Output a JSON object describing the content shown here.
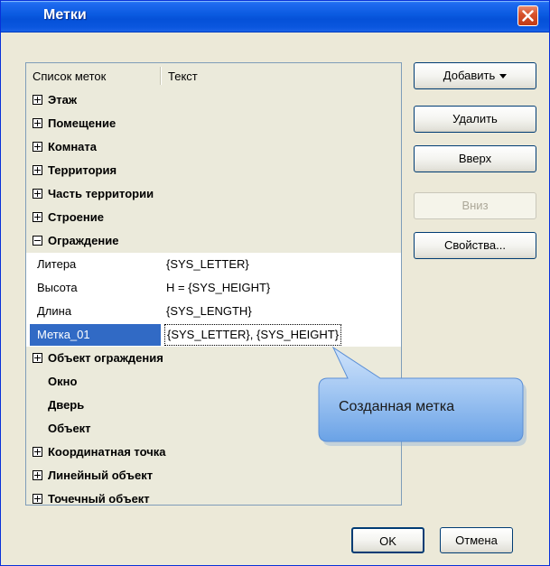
{
  "window": {
    "title": "Метки"
  },
  "list": {
    "headers": {
      "col1": "Список меток",
      "col2": "Текст"
    },
    "groups": [
      {
        "label": "Этаж",
        "expander": "plus"
      },
      {
        "label": "Помещение",
        "expander": "plus"
      },
      {
        "label": "Комната",
        "expander": "plus"
      },
      {
        "label": "Территория",
        "expander": "plus"
      },
      {
        "label": "Часть территории",
        "expander": "plus"
      },
      {
        "label": "Строение",
        "expander": "plus"
      },
      {
        "label": "Ограждение",
        "expander": "minus"
      }
    ],
    "items": [
      {
        "name": "Литера",
        "text": "{SYS_LETTER}"
      },
      {
        "name": "Высота",
        "text": "H = {SYS_HEIGHT}"
      },
      {
        "name": "Длина",
        "text": "{SYS_LENGTH}"
      },
      {
        "name": "Метка_01",
        "text": "{SYS_LETTER}, {SYS_HEIGHT}",
        "selected": true
      }
    ],
    "groups_after": [
      {
        "label": "Объект ограждения",
        "expander": "plus"
      },
      {
        "label": "Окно",
        "expander": "none"
      },
      {
        "label": "Дверь",
        "expander": "none"
      },
      {
        "label": "Объект",
        "expander": "none"
      },
      {
        "label": "Координатная точка",
        "expander": "plus"
      },
      {
        "label": "Линейный объект",
        "expander": "plus"
      },
      {
        "label": "Точечный объект",
        "expander": "plus"
      }
    ]
  },
  "buttons": {
    "add": "Добавить",
    "delete": "Удалить",
    "up": "Вверх",
    "down": "Вниз",
    "properties": "Свойства...",
    "ok": "OK",
    "cancel": "Отмена"
  },
  "callout": {
    "text": "Созданная метка"
  },
  "colors": {
    "titlebar": "#0551d8",
    "selection": "#316ac5",
    "callout_fill": "#7fb2ec",
    "close_button": "#d7532d"
  },
  "icons": {
    "close": "close-icon",
    "add_dropdown": "chevron-down-icon",
    "expand": "plus-box-icon",
    "collapse": "minus-box-icon"
  }
}
